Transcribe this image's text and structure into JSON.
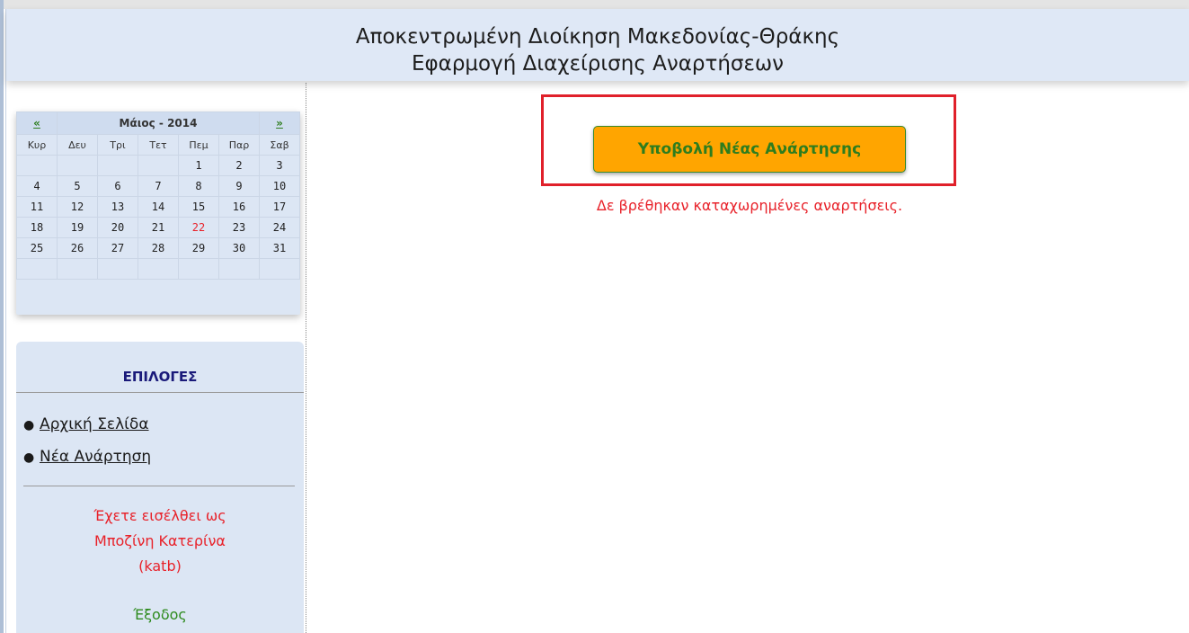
{
  "header": {
    "line1": "Αποκεντρωμένη Διοίκηση Μακεδονίας-Θράκης",
    "line2": "Εφαρμογή Διαχείρισης Αναρτήσεων"
  },
  "calendar": {
    "prev": "«",
    "next": "»",
    "month_label": "Μάιος - 2014",
    "weekdays": [
      "Κυρ",
      "Δευ",
      "Τρι",
      "Τετ",
      "Πεμ",
      "Παρ",
      "Σαβ"
    ],
    "weeks": [
      [
        "",
        "",
        "",
        "",
        "1",
        "2",
        "3"
      ],
      [
        "4",
        "5",
        "6",
        "7",
        "8",
        "9",
        "10"
      ],
      [
        "11",
        "12",
        "13",
        "14",
        "15",
        "16",
        "17"
      ],
      [
        "18",
        "19",
        "20",
        "21",
        "22",
        "23",
        "24"
      ],
      [
        "25",
        "26",
        "27",
        "28",
        "29",
        "30",
        "31"
      ],
      [
        "",
        "",
        "",
        "",
        "",
        "",
        ""
      ]
    ],
    "today": "22",
    "today_color": "#e8222a"
  },
  "options": {
    "title": "ΕΠΙΛΟΓΕΣ",
    "items": [
      {
        "label": "Αρχική Σελίδα"
      },
      {
        "label": "Νέα Ανάρτηση"
      }
    ],
    "logged_line1": "Έχετε εισέλθει ως",
    "logged_line2": "Μποζίνη Κατερίνα",
    "logged_line3": "(katb)",
    "logout": "Έξοδος"
  },
  "main": {
    "submit_button": "Υποβολή Νέας Ανάρτησης",
    "no_results": "Δε βρέθηκαν καταχωρημένες αναρτήσεις."
  },
  "colors": {
    "accent_orange": "#ffa500",
    "header_bg": "#dfe8f6",
    "error_red": "#e8222a",
    "green_text": "#2e7d1e",
    "highlight_red": "#e0202a"
  }
}
